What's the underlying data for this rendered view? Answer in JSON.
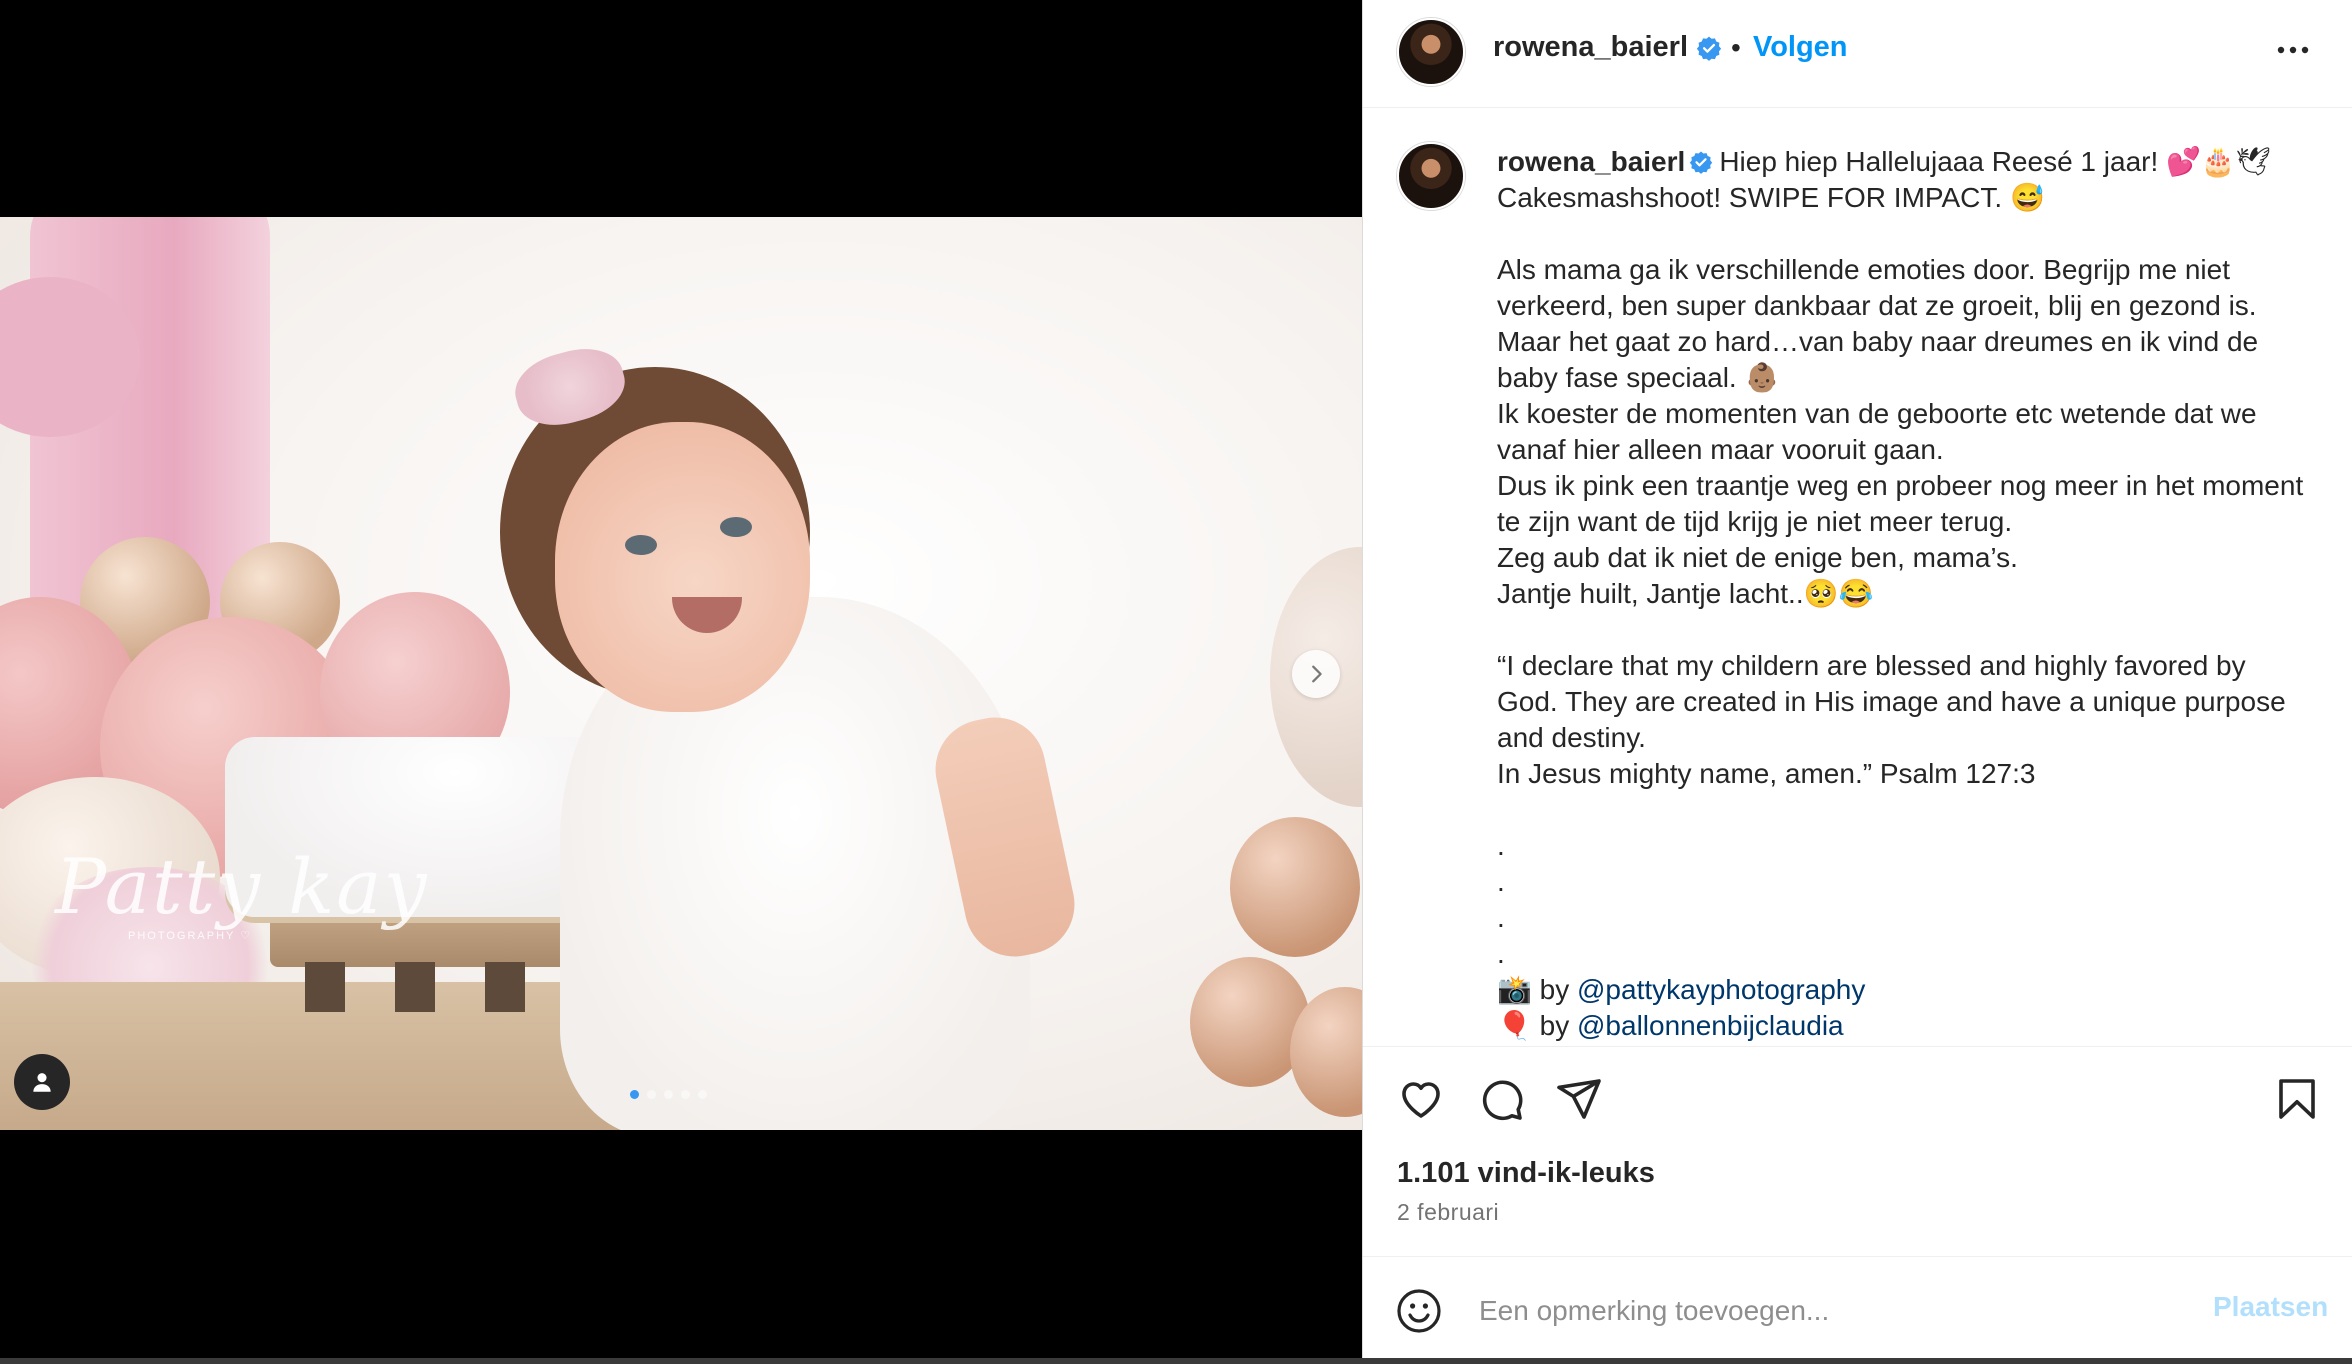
{
  "post": {
    "username": "rowena_baierl",
    "follow_label": "Volgen",
    "bullet": "•",
    "caption_text": "Hiep hiep Hallelujaaa Reesé 1 jaar! 💕🎂🕊\nCakesmashshoot! SWIPE FOR IMPACT. 😅\n\nAls mama ga ik verschillende emoties door. Begrijp me niet verkeerd, ben super dankbaar dat ze groeit, blij en gezond is. Maar het gaat zo hard…van baby naar dreumes en ik vind de baby fase speciaal. 👶🏽\nIk koester de momenten van de geboorte etc wetende dat we vanaf hier alleen maar vooruit gaan.\nDus ik pink een traantje weg en probeer nog meer in het moment te zijn want de tijd krijg je niet meer terug.\nZeg aub dat ik niet de enige ben, mama’s.\nJantje huilt, Jantje lacht..🥺😂\n\n“I declare that my childern are blessed and highly favored by God. They are created in His image and have a unique purpose and destiny.\nIn Jesus mighty name, amen.” Psalm 127:3\n\n.\n.\n.\n.",
    "credit_1_prefix": "📸 by ",
    "credit_1_link": "@pattykayphotography",
    "credit_2_prefix": "🎈 by ",
    "credit_2_link": "@ballonnenbijclaudia",
    "likes": "1.101 vind-ik-leuks",
    "date": "2 februari"
  },
  "media": {
    "watermark": "Patty kay",
    "watermark_sub": "PHOTOGRAPHY ♡",
    "carousel_count": 5,
    "carousel_active": 0
  },
  "comment": {
    "placeholder": "Een opmerking toevoegen...",
    "post_label": "Plaatsen"
  },
  "icons": {
    "like": "heart-icon",
    "comment": "comment-icon",
    "share": "send-icon",
    "save": "bookmark-icon",
    "emoji": "emoji-icon",
    "more": "more-icon",
    "next": "chevron-right-icon",
    "tag": "user-tag-icon",
    "verified": "verified-badge-icon"
  },
  "colors": {
    "link": "#00376b",
    "follow": "#0095f6",
    "verified": "#3897f0",
    "post_disabled": "#b2dffc"
  }
}
